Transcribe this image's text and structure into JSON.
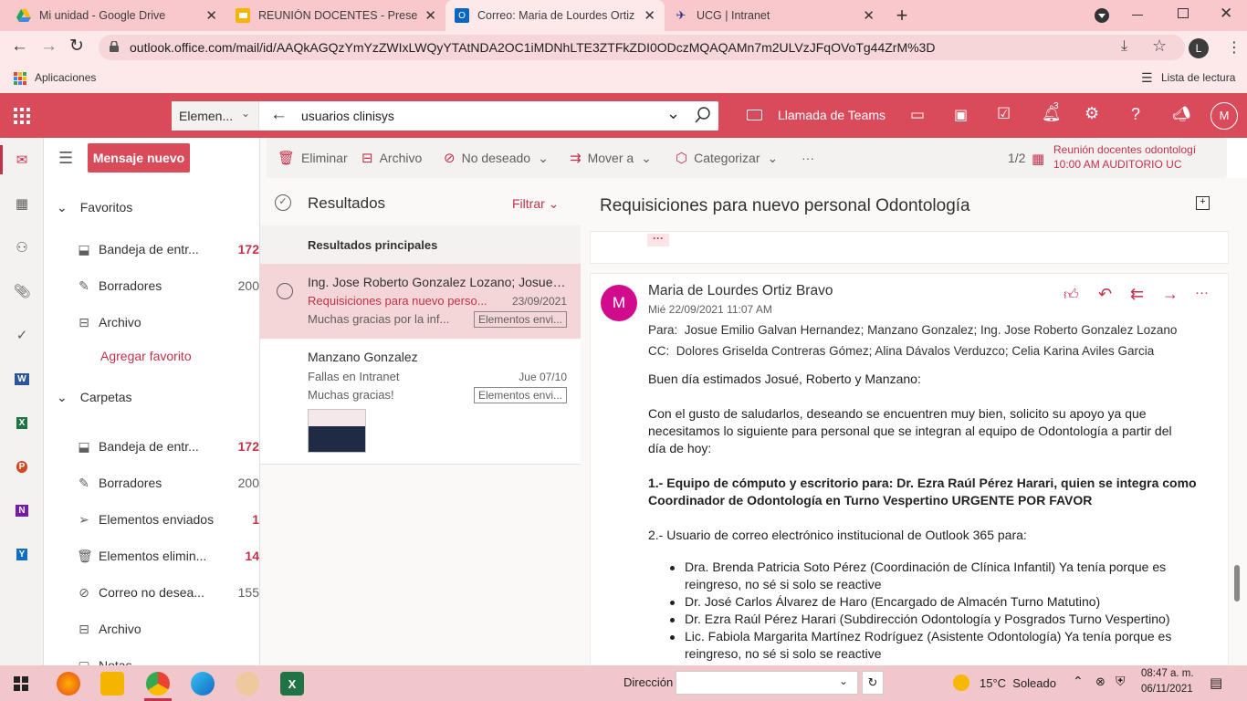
{
  "browser": {
    "tabs": [
      {
        "title": "Mi unidad - Google Drive",
        "icon": "google-drive-icon",
        "close": "✕"
      },
      {
        "title": "REUNIÓN DOCENTES - Presentac",
        "icon": "google-slides-icon",
        "close": "✕"
      },
      {
        "title": "Correo: Maria de Lourdes Ortiz B",
        "icon": "outlook-icon",
        "close": "✕"
      },
      {
        "title": "UCG | Intranet",
        "icon": "ucg-icon",
        "close": "✕"
      }
    ],
    "new_tab": "+",
    "url": "outlook.office.com/mail/id/AAQkAGQzYmYzZWIxLWQyYTAtNDA2OC1iMDNhLTE3ZTFkZDI0ODczMQAQAMn7m2ULVzJFqOVoTg44ZrM%3D",
    "profile_letter": "L",
    "bookmarks_apps": "Aplicaciones",
    "reading_list": "Lista de lectura"
  },
  "outlook": {
    "search_scope": "Elemen...",
    "search_query": "usuarios clinisys",
    "teams_call": "Llamada de Teams",
    "notif_count": "3",
    "avatar_letter": "M"
  },
  "folders": {
    "new_message": "Mensaje nuevo",
    "favorites_title": "Favoritos",
    "favorites": [
      {
        "label": "Bandeja de entr...",
        "count": "172",
        "icon": "inbox-icon",
        "red": true
      },
      {
        "label": "Borradores",
        "count": "200",
        "icon": "pencil-icon",
        "red": false
      },
      {
        "label": "Archivo",
        "count": "",
        "icon": "archive-icon",
        "red": false
      }
    ],
    "add_favorite": "Agregar favorito",
    "folders_title": "Carpetas",
    "items": [
      {
        "label": "Bandeja de entr...",
        "count": "172",
        "icon": "inbox-icon",
        "red": true
      },
      {
        "label": "Borradores",
        "count": "200",
        "icon": "pencil-icon",
        "red": false
      },
      {
        "label": "Elementos enviados",
        "count": "1",
        "icon": "send-icon",
        "red": true
      },
      {
        "label": "Elementos elimin...",
        "count": "14",
        "icon": "trash-icon",
        "red": true
      },
      {
        "label": "Correo no desea...",
        "count": "155",
        "icon": "block-icon",
        "red": false
      },
      {
        "label": "Archivo",
        "count": "",
        "icon": "archive-icon",
        "red": false
      },
      {
        "label": "Notas",
        "count": "",
        "icon": "note-icon",
        "red": false
      }
    ]
  },
  "toolbar": {
    "delete": "Eliminar",
    "archive": "Archivo",
    "junk": "No deseado",
    "move": "Mover a",
    "categorize": "Categorizar",
    "more": "···",
    "page": "1/2",
    "event_title": "Reunión docentes odontologí",
    "event_time": "10:00 AM AUDITORIO UC"
  },
  "list": {
    "title": "Resultados",
    "filter": "Filtrar",
    "section": "Resultados principales",
    "messages": [
      {
        "sender": "Ing. Jose Roberto Gonzalez Lozano; Josue E...",
        "subject": "Requisiciones para nuevo perso...",
        "date": "23/09/2021",
        "preview": "Muchas gracias por la inf...",
        "tag": "Elementos envi..."
      },
      {
        "sender": "Manzano Gonzalez",
        "subject": "Fallas en Intranet",
        "date": "Jue 07/10",
        "preview": "Muchas gracias!",
        "tag": "Elementos envi..."
      }
    ]
  },
  "reading": {
    "subject": "Requisiciones para nuevo personal Odontología",
    "collapsed": "···",
    "avatar": "M",
    "from": "Maria de Lourdes Ortiz Bravo",
    "sent": "Mié 22/09/2021 11:07 AM",
    "to_label": "Para:",
    "to": "Josue Emilio Galvan Hernandez; Manzano Gonzalez; Ing. Jose Roberto Gonzalez Lozano",
    "cc_label": "CC:",
    "cc": "Dolores Griselda Contreras Gómez; Alina Dávalos Verduzco; Celia Karina Aviles Garcia",
    "greeting": "Buen día estimados Josué, Roberto y Manzano:",
    "intro1": "Con el gusto de saludarlos, deseando se encuentren muy bien, solicito su apoyo ya que",
    "intro2": "necesitamos lo siguiente para personal que se integran al equipo de Odontología a partir del",
    "intro3": "día de hoy:",
    "item1a": "1.- Equipo de cómputo y escritorio para: Dr. Ezra Raúl Pérez Harari, quien se integra como",
    "item1b": "Coordinador de Odontología en Turno Vespertino URGENTE POR FAVOR",
    "item2": "2.- Usuario de correo electrónico institucional de Outlook 365 para:",
    "bullets": [
      "Dra. Brenda Patricia Soto Pérez (Coordinación de Clínica Infantil) Ya tenía porque es",
      "reingreso, no sé si solo se reactive",
      "Dr. José Carlos Álvarez de Haro (Encargado de Almacén Turno Matutino)",
      "Dr. Ezra Raúl Pérez Harari (Subdirección Odontología y Posgrados Turno Vespertino)",
      "Lic. Fabiola Margarita Martínez Rodríguez (Asistente Odontología) Ya tenía porque es",
      "reingreso, no sé si solo se reactive"
    ]
  },
  "taskbar": {
    "address_label": "Dirección",
    "weather": "15°C  Soleado",
    "time": "08:47 a. m.",
    "date": "06/11/2021"
  },
  "colors": {
    "brand": "#d94b5a",
    "accent": "#c4314b",
    "tab_strip": "#f8c8cc"
  }
}
